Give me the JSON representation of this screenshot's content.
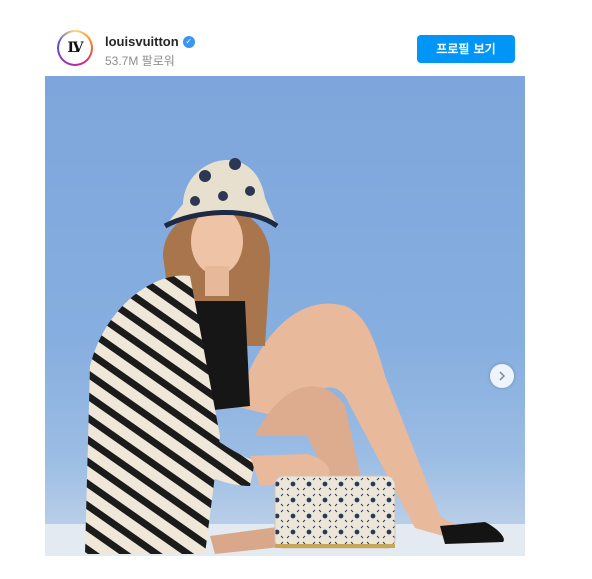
{
  "post": {
    "username": "louisvuitton",
    "followers": "53.7M 팔로워",
    "profile_button_label": "프로필 보기",
    "avatar_monogram": "LV"
  },
  "icons": {
    "verified": "verified-badge-icon",
    "next": "chevron-right-icon"
  },
  "colors": {
    "button": "#0095f6",
    "verified": "#3897f0",
    "photo_background": "#86aedf"
  }
}
